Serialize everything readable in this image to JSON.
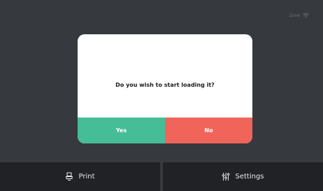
{
  "status": {
    "label": "Zone",
    "icon": "wifi-icon"
  },
  "dialog": {
    "message": "Do you wish to start loading it?",
    "yes_label": "Yes",
    "no_label": "No"
  },
  "nav": [
    {
      "label": "Print",
      "icon": "printer-icon"
    },
    {
      "label": "Settings",
      "icon": "sliders-icon"
    }
  ],
  "colors": {
    "background": "#36393e",
    "nav_background": "#202225",
    "yes": "#45bd96",
    "no": "#f0645a"
  }
}
